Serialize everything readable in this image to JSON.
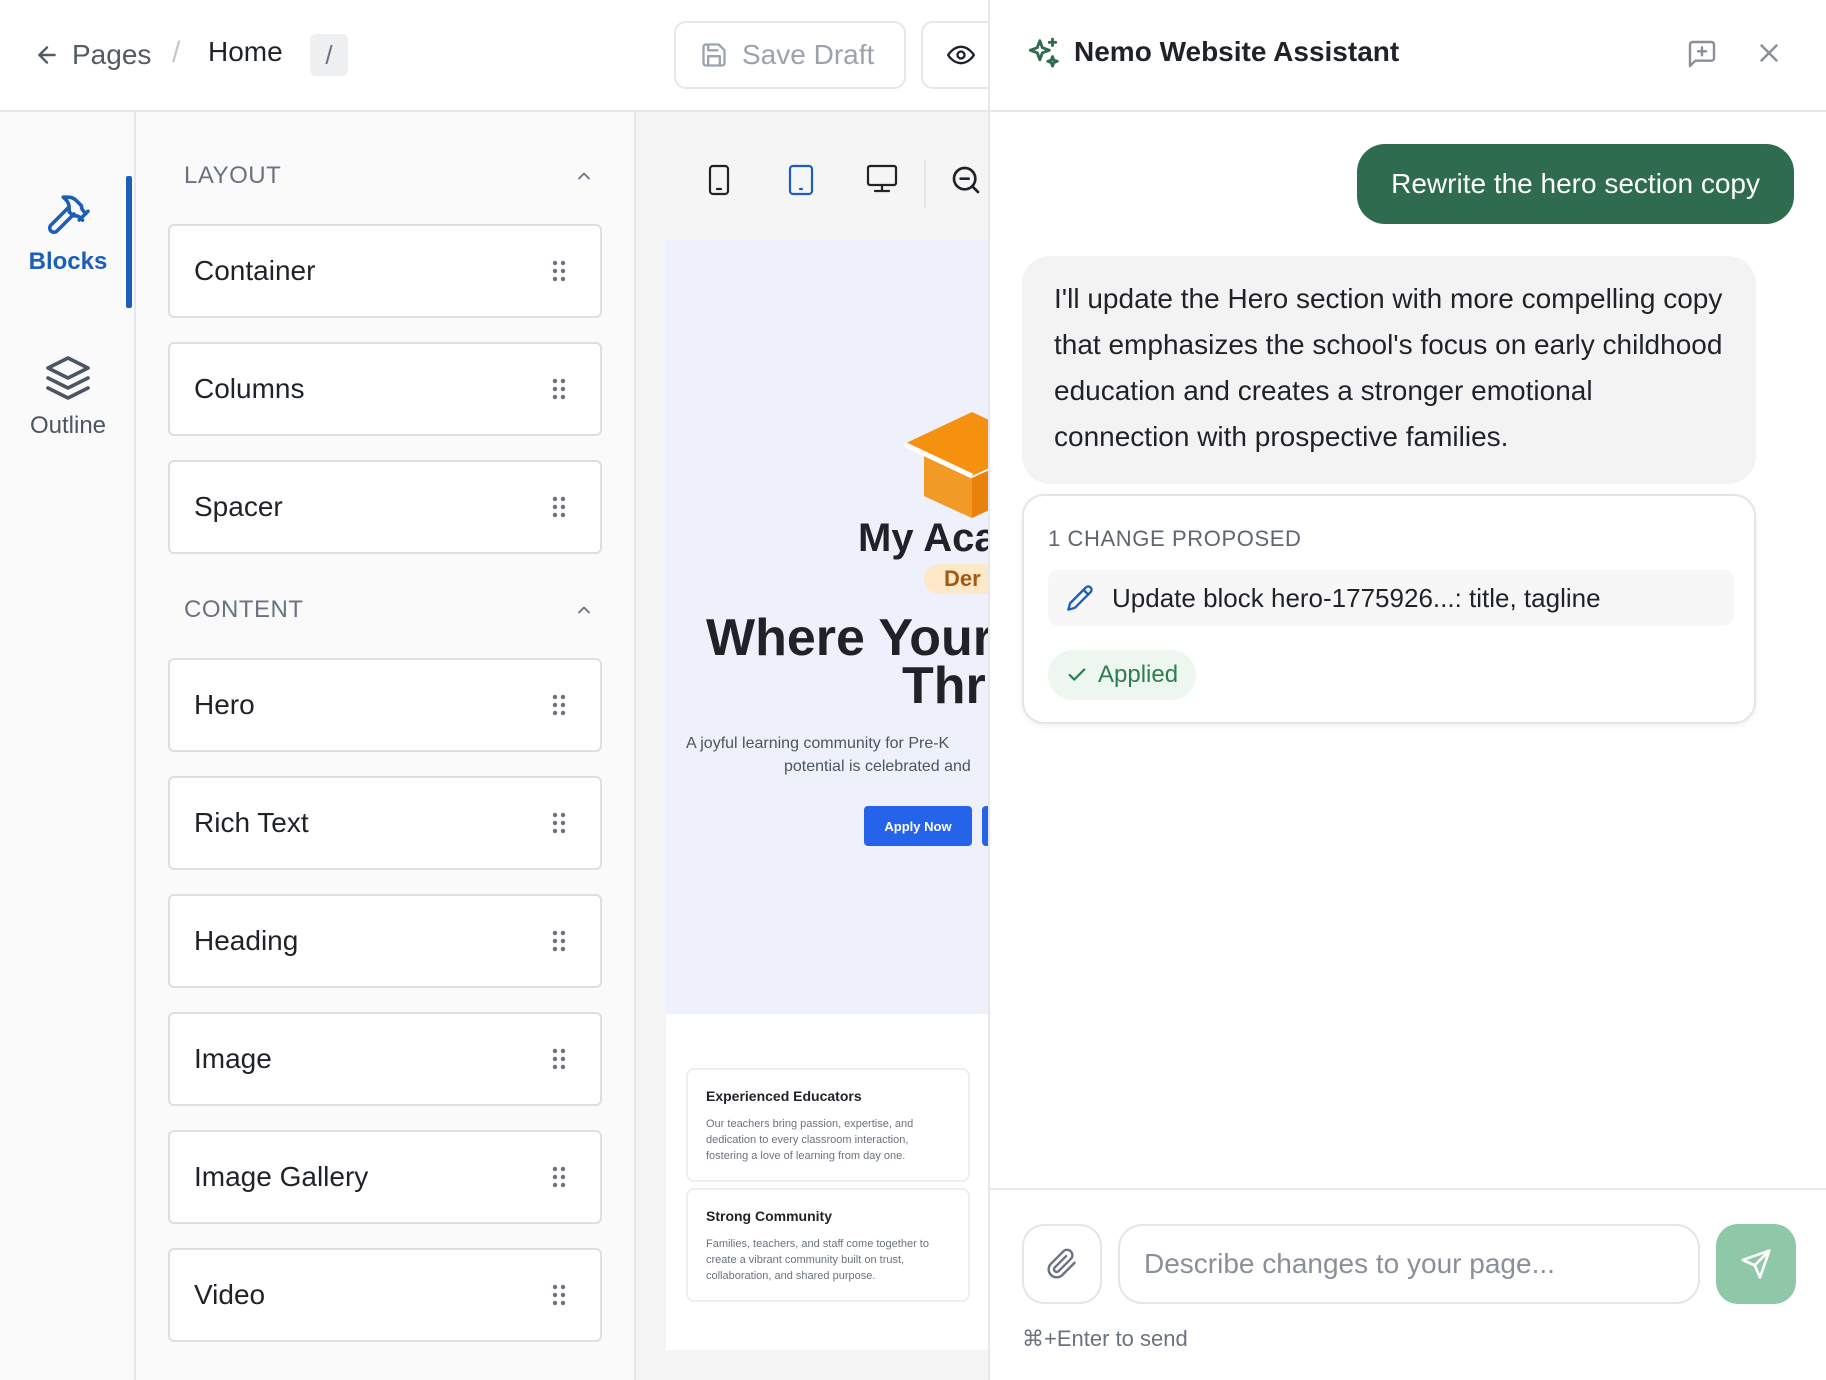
{
  "header": {
    "back_label": "Pages",
    "breadcrumb_sep": "/",
    "page_name": "Home",
    "page_slug": "/",
    "save_draft_label": "Save Draft"
  },
  "rail": {
    "items": [
      {
        "label": "Blocks",
        "icon": "hammer-icon",
        "active": true
      },
      {
        "label": "Outline",
        "icon": "layers-icon",
        "active": false
      }
    ]
  },
  "blocks_panel": {
    "layout_heading": "LAYOUT",
    "layout_blocks": [
      "Container",
      "Columns",
      "Spacer"
    ],
    "content_heading": "CONTENT",
    "content_blocks": [
      "Hero",
      "Rich Text",
      "Heading",
      "Image",
      "Image Gallery",
      "Video"
    ]
  },
  "canvas": {
    "site_name": "My Aca",
    "badge": "Der",
    "hero_title_line1": "Where Your",
    "hero_title_line2": "Thr",
    "hero_tagline_line1": "A joyful learning community for Pre-K",
    "hero_tagline_line2": "potential is celebrated and",
    "apply_button": "Apply Now",
    "features": [
      {
        "title": "Experienced Educators",
        "body": "Our teachers bring passion, expertise, and dedication to every classroom interaction, fostering a love of learning from day one."
      },
      {
        "title": "Strong Community",
        "body": "Families, teachers, and staff come together to create a vibrant community built on trust, collaboration, and shared purpose."
      }
    ]
  },
  "assistant": {
    "title": "Nemo Website Assistant",
    "user_message": "Rewrite the hero section copy",
    "ai_message": "I'll update the Hero section with more compelling copy that emphasizes the school's focus on early childhood education and creates a stronger emotional connection with prospective families.",
    "change_header": "1 CHANGE PROPOSED",
    "change_item": "Update block hero-1775926...: title, tagline",
    "change_status": "Applied",
    "input_placeholder": "Describe changes to your page...",
    "send_hint": "⌘+Enter to send"
  },
  "colors": {
    "accent_blue": "#1d5fb8",
    "assistant_green": "#2e6b4f",
    "send_button": "#8fc8a8",
    "applied_green": "#2e7d50"
  }
}
